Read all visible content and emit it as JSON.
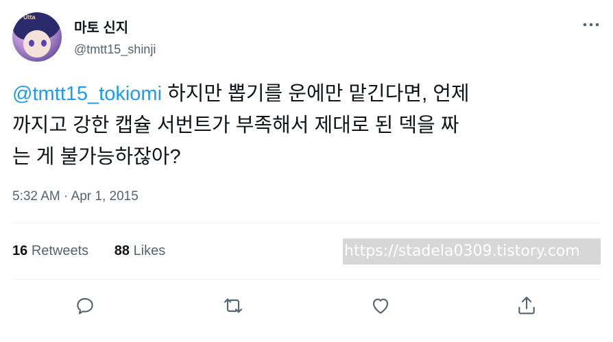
{
  "user": {
    "display_name": "마토 신지",
    "handle": "@tmtt15_shinji",
    "avatar_badge": "Utta"
  },
  "tweet": {
    "mention": "@tmtt15_tokiomi",
    "line1_rest": " 하지만 뽑기를 운에만 맡긴다면, 언제",
    "line2": "까지고 강한 캡슐 서번트가 부족해서 제대로 된 덱을 짜",
    "line3": "는 게 불가능하잖아?",
    "timestamp": "5:32 AM · Apr 1, 2015"
  },
  "stats": {
    "retweets_count": "16",
    "retweets_label": "Retweets",
    "likes_count": "88",
    "likes_label": "Likes"
  },
  "watermark": "https://stadela0309.tistory.com",
  "icons": {
    "reply": "reply-icon",
    "retweet": "retweet-icon",
    "like": "like-icon",
    "share": "share-icon",
    "more": "more-icon"
  },
  "colors": {
    "accent": "#1d9bf0",
    "secondary_text": "#536471",
    "primary_text": "#0f1419"
  }
}
